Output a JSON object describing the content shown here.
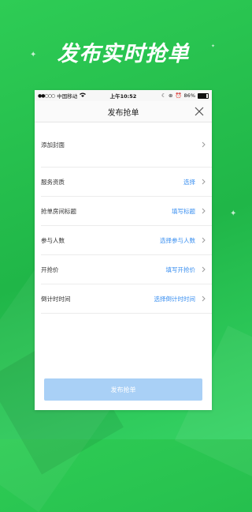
{
  "promo": {
    "headline": "发布实时抢单"
  },
  "status_bar": {
    "carrier": "中国移动",
    "time": "上午10:52",
    "battery_text": "86%",
    "battery_level": 0.86
  },
  "nav": {
    "title": "发布抢单"
  },
  "form": {
    "rows": [
      {
        "label": "添加封面",
        "value": ""
      },
      {
        "label": "服务资质",
        "value": "选择"
      },
      {
        "label": "抢单房间标题",
        "value": "填写标题"
      },
      {
        "label": "参与人数",
        "value": "选择参与人数"
      },
      {
        "label": "开抢价",
        "value": "填写开抢价"
      },
      {
        "label": "倒计时时间",
        "value": "选择倒计时时间"
      }
    ]
  },
  "submit": {
    "label": "发布抢单"
  },
  "colors": {
    "background": "#22b94a",
    "link": "#3a8ff0",
    "submit_disabled": "#a9d0f6"
  },
  "icons": {
    "close": "close-icon",
    "chevron": "chevron-right-icon",
    "wifi": "wifi-icon",
    "battery": "battery-icon"
  }
}
